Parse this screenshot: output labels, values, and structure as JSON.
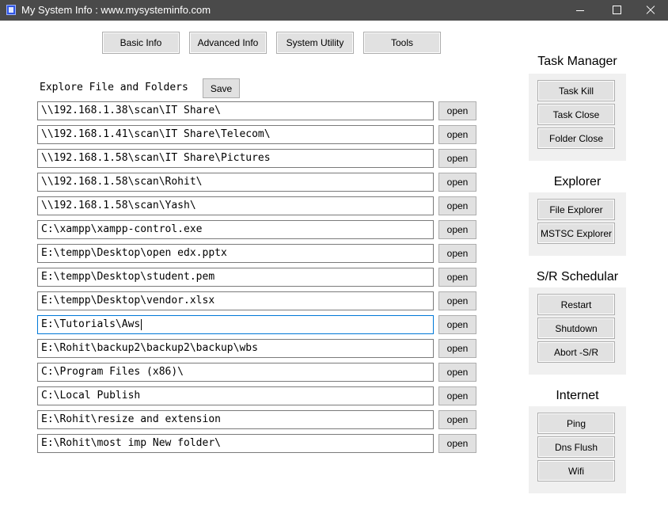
{
  "window": {
    "title": "My System Info : www.mysysteminfo.com"
  },
  "tabs": [
    {
      "label": "Basic Info"
    },
    {
      "label": "Advanced Info"
    },
    {
      "label": "System Utility"
    },
    {
      "label": "Tools"
    }
  ],
  "explore": {
    "label": "Explore File and Folders",
    "save_label": "Save",
    "open_label": "open",
    "paths": [
      "\\\\192.168.1.38\\scan\\IT Share\\",
      "\\\\192.168.1.41\\scan\\IT Share\\Telecom\\",
      "\\\\192.168.1.58\\scan\\IT Share\\Pictures",
      "\\\\192.168.1.58\\scan\\Rohit\\",
      "\\\\192.168.1.58\\scan\\Yash\\",
      "C:\\xampp\\xampp-control.exe",
      "E:\\tempp\\Desktop\\open edx.pptx",
      "E:\\tempp\\Desktop\\student.pem",
      "E:\\tempp\\Desktop\\vendor.xlsx",
      "E:\\Tutorials\\Aws",
      "E:\\Rohit\\backup2\\backup2\\backup\\wbs",
      "C:\\Program Files (x86)\\",
      "C:\\Local Publish",
      "E:\\Rohit\\resize and extension",
      "E:\\Rohit\\most imp New folder\\"
    ]
  },
  "task_manager": {
    "title": "Task Manager",
    "buttons": [
      "Task Kill",
      "Task Close",
      "Folder Close"
    ]
  },
  "explorer": {
    "title": "Explorer",
    "buttons": [
      "File Explorer",
      "MSTSC Explorer"
    ]
  },
  "schedular": {
    "title": "S/R Schedular",
    "buttons": [
      "Restart",
      "Shutdown",
      "Abort -S/R"
    ]
  },
  "internet": {
    "title": "Internet",
    "buttons": [
      "Ping",
      "Dns Flush",
      "Wifi"
    ]
  }
}
